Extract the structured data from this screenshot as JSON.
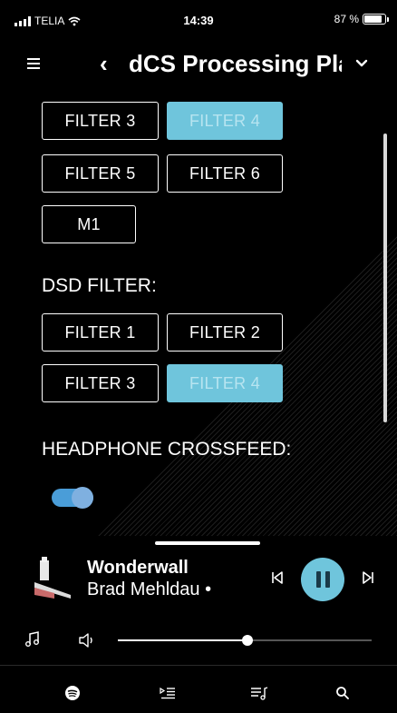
{
  "status": {
    "carrier": "TELIA",
    "time": "14:39",
    "battery": "87 %",
    "battery_level": 0.87
  },
  "header": {
    "title": "dCS Processing Pla",
    "menu_icon": "hamburger-icon",
    "back_icon": "back-chevron-icon",
    "dropdown_icon": "chevron-down-icon"
  },
  "pcm_filters": {
    "f3": "FILTER 3",
    "f4": "FILTER 4",
    "f5": "FILTER 5",
    "f6": "FILTER 6",
    "m1": "M1",
    "active": "FILTER 4"
  },
  "dsd_filter": {
    "label": "DSD FILTER:",
    "f1": "FILTER 1",
    "f2": "FILTER 2",
    "f3": "FILTER 3",
    "f4": "FILTER 4",
    "active": "FILTER 4"
  },
  "crossfeed": {
    "label": "HEADPHONE CROSSFEED:",
    "enabled": true
  },
  "now_playing": {
    "title": "Wonderwall",
    "artist": "Brad Mehldau •"
  },
  "volume": {
    "level": 0.51
  },
  "tabs": [
    {
      "icon": "spotify-icon"
    },
    {
      "icon": "queue-icon"
    },
    {
      "icon": "library-icon"
    },
    {
      "icon": "search-icon"
    }
  ],
  "colors": {
    "accent": "#6fc5dc",
    "toggle": "#4a9dd8",
    "background": "#000000"
  }
}
